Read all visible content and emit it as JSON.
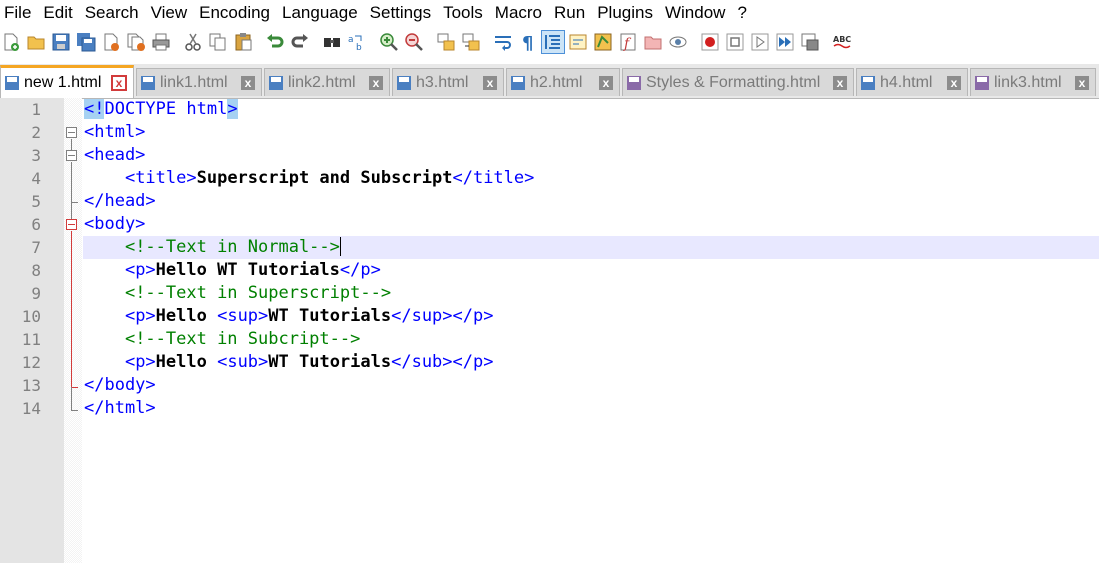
{
  "menu": [
    "File",
    "Edit",
    "Search",
    "View",
    "Encoding",
    "Language",
    "Settings",
    "Tools",
    "Macro",
    "Run",
    "Plugins",
    "Window",
    "?"
  ],
  "toolbar_icons": [
    "new-file",
    "open-file",
    "save",
    "save-all",
    "close",
    "close-all",
    "print",
    "cut",
    "copy",
    "paste",
    "undo",
    "redo",
    "find",
    "replace",
    "zoom-in",
    "zoom-out",
    "sync-vertical",
    "sync-horizontal",
    "word-wrap",
    "show-all-chars",
    "indent-guide",
    "doc-map",
    "function-list",
    "folder-as-workspace",
    "monitor",
    "eye",
    "record-macro",
    "stop-macro",
    "play-macro",
    "run-macro-multiple",
    "save-macro",
    "spell-check"
  ],
  "tabs": [
    {
      "label": "new 1.html",
      "active": true
    },
    {
      "label": "link1.html",
      "active": false
    },
    {
      "label": "link2.html",
      "active": false
    },
    {
      "label": "h3.html",
      "active": false
    },
    {
      "label": "h2.html",
      "active": false
    },
    {
      "label": "Styles & Formatting.html",
      "active": false
    },
    {
      "label": "h4.html",
      "active": false
    },
    {
      "label": "link3.html",
      "active": false
    }
  ],
  "tab_close_glyph": "x",
  "line_numbers": [
    "1",
    "2",
    "3",
    "4",
    "5",
    "6",
    "7",
    "8",
    "9",
    "10",
    "11",
    "12",
    "13",
    "14"
  ],
  "code": {
    "l1": {
      "hl": "<!",
      "rest": "DOCTYPE html",
      "end": ">"
    },
    "l2": "<html>",
    "l3": "<head>",
    "l4": {
      "indent": "    ",
      "open": "<title>",
      "text": "Superscript and Subscript",
      "close": "</title>"
    },
    "l5": "</head>",
    "l6": "<body>",
    "l7": {
      "indent": "    ",
      "comment": "<!--Text in Normal-->"
    },
    "l8": {
      "indent": "    ",
      "open": "<p>",
      "text": "Hello WT Tutorials",
      "close": "</p>"
    },
    "l9": {
      "indent": "    ",
      "comment": "<!--Text in Superscript-->"
    },
    "l10": {
      "indent": "    ",
      "open": "<p>",
      "text": "Hello ",
      "open2": "<sup>",
      "text2": "WT Tutorials",
      "close2": "</sup>",
      "close": "</p>"
    },
    "l11": {
      "indent": "    ",
      "comment": "<!--Text in Subcript-->"
    },
    "l12": {
      "indent": "    ",
      "open": "<p>",
      "text": "Hello ",
      "open2": "<sub>",
      "text2": "WT Tutorials",
      "close2": "</sub>",
      "close": "</p>"
    },
    "l13": "</body>",
    "l14": "</html>"
  },
  "colors": {
    "tag": "#0000ff",
    "comment": "#008000",
    "current_line": "#e8e8ff",
    "active_tab_accent": "#f5a623",
    "fold_active": "#d23b3b"
  }
}
